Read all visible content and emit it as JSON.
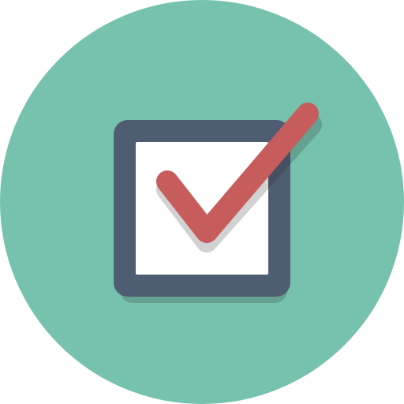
{
  "icon": {
    "name": "checkbox-checked-icon",
    "colors": {
      "circle_background": "#76C2AF",
      "box_border": "#4F5D73",
      "box_fill": "#FFFFFF",
      "checkmark": "#C75C5C",
      "shadow": "#231F20"
    }
  }
}
